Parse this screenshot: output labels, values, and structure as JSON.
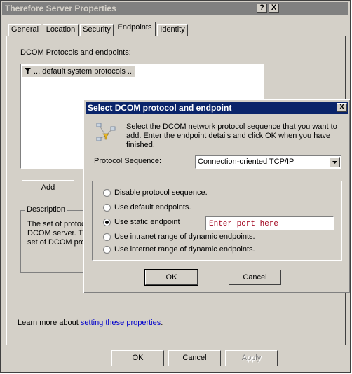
{
  "main_window": {
    "title": "Therefore Server Properties",
    "help_btn": "?",
    "close_btn": "X",
    "tabs": [
      {
        "label": "General"
      },
      {
        "label": "Location"
      },
      {
        "label": "Security"
      },
      {
        "label": "Endpoints"
      },
      {
        "label": "Identity"
      }
    ],
    "protocols_label": "DCOM Protocols and endpoints:",
    "protocol_items": [
      {
        "label": "... default system protocols ..."
      }
    ],
    "add_button": "Add",
    "description": {
      "legend": "Description",
      "lines": [
        "The set of protoc",
        "DCOM server. Th",
        "set of DCOM prot"
      ]
    },
    "learn_more_text": "Learn more about ",
    "learn_more_link": "setting these properties",
    "learn_more_end": ".",
    "ok": "OK",
    "cancel": "Cancel",
    "apply": "Apply"
  },
  "dialog": {
    "title": "Select DCOM protocol and endpoint",
    "close_btn": "X",
    "instructions": "Select the DCOM network protocol sequence that you want to add. Enter the endpoint details and click OK when you have finished.",
    "protocol_label": "Protocol Sequence:",
    "protocol_value": "Connection-oriented TCP/IP",
    "options": [
      {
        "label": "Disable protocol sequence.",
        "selected": false
      },
      {
        "label": "Use default endpoints.",
        "selected": false
      },
      {
        "label": "Use static endpoint",
        "selected": true
      },
      {
        "label": "Use intranet range of dynamic endpoints.",
        "selected": false
      },
      {
        "label": "Use internet range of dynamic endpoints.",
        "selected": false
      }
    ],
    "port_placeholder": "Enter port here",
    "ok": "OK",
    "cancel": "Cancel"
  },
  "colors": {
    "dialog_title_bg": "#0a246a",
    "inactive_title_bg": "#808080",
    "face": "#d4d0c8",
    "placeholder": "#a0001a",
    "link": "#0000cc"
  }
}
